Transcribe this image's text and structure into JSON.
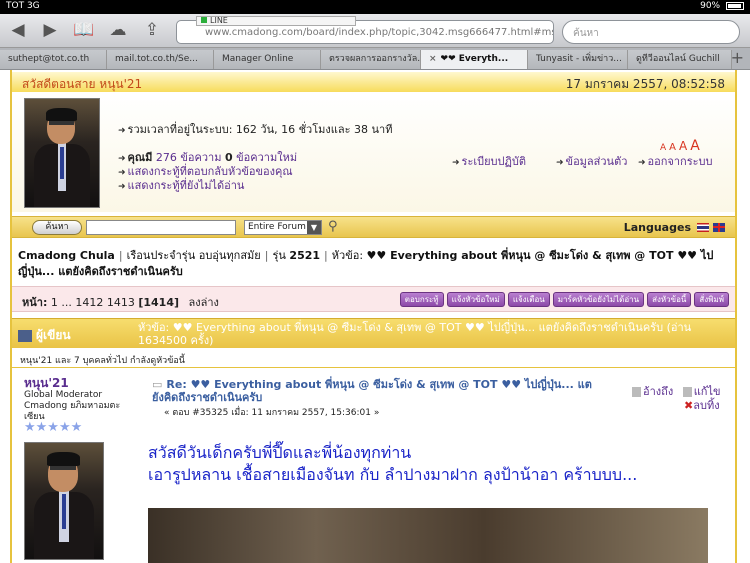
{
  "status_bar": {
    "carrier": "TOT 3G",
    "network": "3G",
    "time": "",
    "battery": "90%",
    "battery_level": 0.9
  },
  "browser": {
    "url": "www.cmadong.com/board/index.php/topic,3042.msg666477.html#msg66",
    "url_tip": "LINE",
    "search_placeholder": "ค้นหา",
    "tabs": [
      {
        "label": "suthept@tot.co.th",
        "active": false
      },
      {
        "label": "mail.tot.co.th/Se...",
        "active": false
      },
      {
        "label": "Manager Online",
        "active": false
      },
      {
        "label": "ตรวจผลการออกรางวัล...",
        "active": false
      },
      {
        "label": "❤❤ Everyth...",
        "active": true,
        "close": "×"
      },
      {
        "label": "Tunyasit - เพิ่มข่าว...",
        "active": false
      },
      {
        "label": "ดูทีวีออนไลน์ Guchill",
        "active": false
      }
    ],
    "new_tab_label": "+"
  },
  "header": {
    "greeting": "สวัสดีตอนสาย หนุน'21",
    "datetime": "17 มกราคม 2557, 08:52:58"
  },
  "userpanel": {
    "online_time": "รวมเวลาที่อยู่ในระบบ: 162 วัน, 16 ชั่วโมงและ 38 นาที",
    "you_have": "คุณมี",
    "msg_count": "276",
    "msg_word": "ข้อความ",
    "new_count": "0",
    "new_word": "ข้อความใหม่",
    "show_replies": "แสดงกระทู้ที่ตอบกลับหัวข้อของคุณ",
    "show_unread": "แสดงกระทู้ที่ยังไม่ได้อ่าน",
    "rules": "ระเบียบปฏิบัติ",
    "profile": "ข้อมูลส่วนตัว",
    "logout": "ออกจากระบบ",
    "font_sizes": [
      "A",
      "A",
      "A",
      "A"
    ]
  },
  "searchbar": {
    "button": "ค้นหา",
    "scope": "Entire Forum",
    "languages": "Languages"
  },
  "breadcrumb": {
    "user": "Cmadong Chula",
    "board": "เรือนประจำรุ่น อบอุ่นทุกสมัย",
    "class_label": "รุ่น",
    "class_no": "2521",
    "topic_label": "หัวข้อ:",
    "topic": "♥♥ Everything about พี่หนุน @ ซีมะโด่ง & สุเทพ @ TOT ♥♥ ไปญี่ปุ่น... แตยังคิดถึงราชดำเนินครับ"
  },
  "pagination": {
    "label": "หน้า:",
    "pages": "1 ... 1412 1413",
    "current": "[1414]",
    "down": "ลงล่าง",
    "actions": [
      "ตอบกระทู้",
      "แจ้งหัวข้อใหม่",
      "แจ้งเตือน",
      "มาร์คหัวข้อยังไม่ได้อ่าน",
      "ส่งหัวข้อนี้",
      "สั่งพิมพ์"
    ]
  },
  "topic_header": {
    "author_col": "ผู้เขียน",
    "title": "หัวข้อ: ♥♥ Everything about พี่หนุน @ ซีมะโด่ง & สุเทพ @ TOT ♥♥ ไปญี่ปุ่น... แตยังคิดถึงราชดำเนินครับ  (อ่าน 1634500 ครั้ง)"
  },
  "viewers": "หนุน'21 และ 7 บุคคลทั่วไป กำลังดูหัวข้อนี้",
  "post": {
    "poster": "หนุน'21",
    "role": "Global Moderator",
    "role2": "Cmadong ยภิมหาอมตะ",
    "role3": "เซียน",
    "stars": "★★★★★",
    "subject": "Re: ♥♥ Everything about พี่หนุน @ ซีมะโด่ง & สุเทพ @ TOT ♥♥ ไปญี่ปุ่น... แตยังคิดถึงราชดำเนินครับ",
    "meta": "« ตอบ #35325 เมื่อ: 11 มกราคม 2557, 15:36:01 »",
    "quote": "อ้างถึง",
    "edit": "แก้ไข",
    "delete": "ลบทิ้ง",
    "body_line1": "สวัสดีวันเด็กครับพี่ปี๊ดและพี่น้องทุกท่าน",
    "body_line2": "เอารูปหลาน เชื้อสายเมืองจันท กับ ลำปางมาฝาก ลุงป้าน้าอา คร้าบบบ..."
  }
}
